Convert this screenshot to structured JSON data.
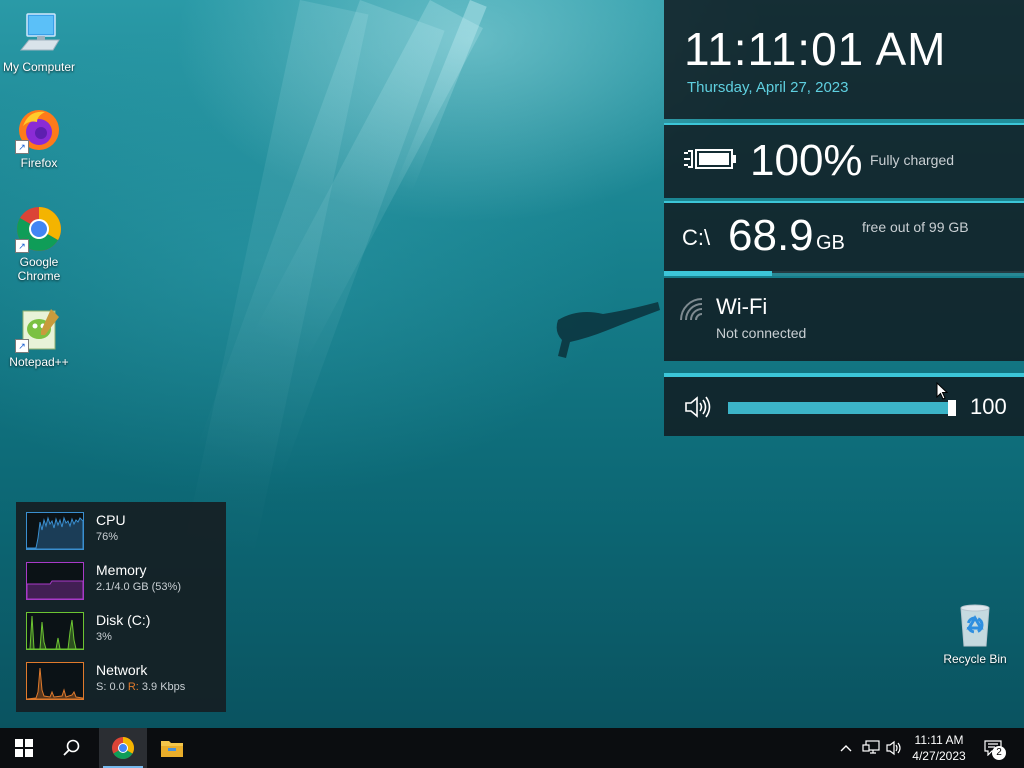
{
  "desktop": {
    "icons": [
      {
        "label": "My Computer"
      },
      {
        "label": "Firefox"
      },
      {
        "label": "Google Chrome"
      },
      {
        "label": "Notepad++"
      },
      {
        "label": "Recycle Bin"
      }
    ]
  },
  "panel": {
    "time": "11:11:01 AM",
    "date": "Thursday, April 27, 2023",
    "battery": {
      "percent": "100%",
      "status": "Fully charged",
      "icon": "battery-plug-icon"
    },
    "disk": {
      "drive": "C:\\",
      "free": "68.9",
      "unit": "GB",
      "label": "free out of 99 GB",
      "used_fraction": 0.3
    },
    "wifi": {
      "name": "Wi-Fi",
      "status": "Not connected",
      "icon": "wifi-icon"
    },
    "volume": {
      "level": "100",
      "fraction": 1.0,
      "icon": "speaker-icon"
    }
  },
  "monitor": {
    "items": [
      {
        "name": "CPU",
        "value": "76%",
        "color": "#3a8fd0"
      },
      {
        "name": "Memory",
        "value": "2.1/4.0 GB (53%)",
        "color": "#a83ac8"
      },
      {
        "name": "Disk (C:)",
        "value": "3%",
        "color": "#6cc432"
      },
      {
        "name": "Network",
        "value_s": "S: 0.0",
        "value_r_label": "R:",
        "value_r": "3.9 Kbps",
        "color": "#e07a2c"
      }
    ]
  },
  "taskbar": {
    "clock_time": "11:11 AM",
    "clock_date": "4/27/2023",
    "notification_count": "2",
    "accent": "#76b9ed"
  }
}
